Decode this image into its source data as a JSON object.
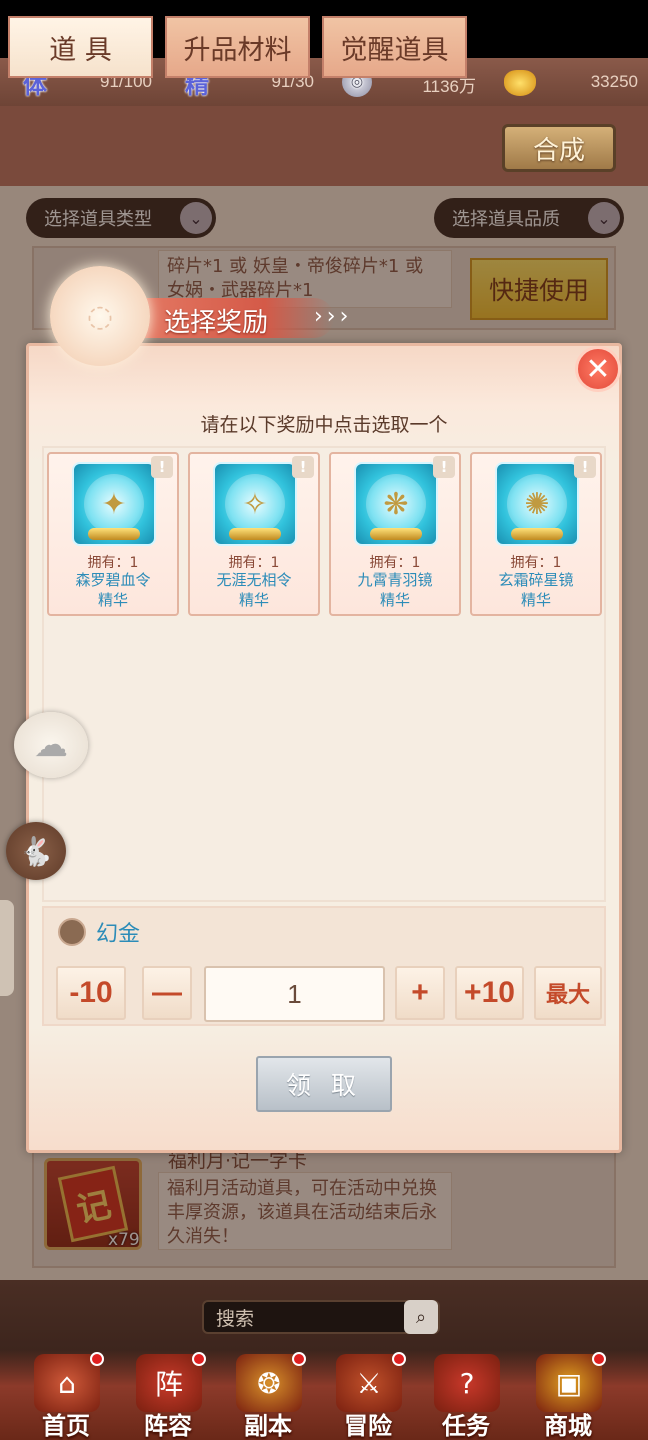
{
  "resources": [
    {
      "icon": "stamina-icon",
      "glyph": "体",
      "value": "91/100"
    },
    {
      "icon": "spirit-icon",
      "glyph": "精",
      "value": "91/30"
    },
    {
      "icon": "silver-coin-icon",
      "glyph": "◎",
      "value": "1136万"
    },
    {
      "icon": "gold-ingot-icon",
      "glyph": "",
      "value": "33250"
    }
  ],
  "tabs": [
    {
      "label": "道 具",
      "active": true
    },
    {
      "label": "升品材料",
      "active": false
    },
    {
      "label": "觉醒道具",
      "active": false
    }
  ],
  "synth_label": "合成",
  "filters": {
    "type_label": "选择道具类型",
    "quality_label": "选择道具品质"
  },
  "bg_item_top": {
    "desc": "碎片*1 或 妖皇・帝俊碎片*1 或 女娲・武器碎片*1",
    "quick_use_label": "快捷使用"
  },
  "bg_item_bottom": {
    "title": "福利月·记一字卡",
    "desc": "福利月活动道具，可在活动中兑换丰厚资源，该道具在活动结束后永久消失！",
    "icon_glyph": "记",
    "count": "x79"
  },
  "dialog": {
    "banner_title": "选择奖励",
    "prompt": "请在以下奖励中点击选取一个",
    "rewards": [
      {
        "owned": "拥有：1",
        "name_line1": "森罗碧血令",
        "name_line2": "精华"
      },
      {
        "owned": "拥有：1",
        "name_line1": "无涯无相令",
        "name_line2": "精华"
      },
      {
        "owned": "拥有：1",
        "name_line1": "九霄青羽镜",
        "name_line2": "精华"
      },
      {
        "owned": "拥有：1",
        "name_line1": "玄霜碎星镜",
        "name_line2": "精华"
      }
    ],
    "selected_name": "幻金",
    "qty": {
      "minus10": "-10",
      "minus": "—",
      "value": "1",
      "plus": "+",
      "plus10": "+10",
      "max": "最大"
    },
    "claim_label": "领 取"
  },
  "search": {
    "placeholder": "搜索"
  },
  "nav": [
    {
      "label": "首页",
      "icon": "home-icon",
      "glyph": "⌂",
      "color": "#d05a3a",
      "pin": true
    },
    {
      "label": "阵容",
      "icon": "lineup-icon",
      "glyph": "阵",
      "color": "#c83a2a",
      "pin": true
    },
    {
      "label": "副本",
      "icon": "dungeon-icon",
      "glyph": "❂",
      "color": "#d8902a",
      "pin": true
    },
    {
      "label": "冒险",
      "icon": "adventure-icon",
      "glyph": "⚔",
      "color": "#c0502a",
      "pin": true
    },
    {
      "label": "任务",
      "icon": "quest-icon",
      "glyph": "?",
      "color": "#c8382a",
      "pin": false
    },
    {
      "label": "商城",
      "icon": "shop-icon",
      "glyph": "▣",
      "color": "#e0a020",
      "pin": true
    }
  ]
}
